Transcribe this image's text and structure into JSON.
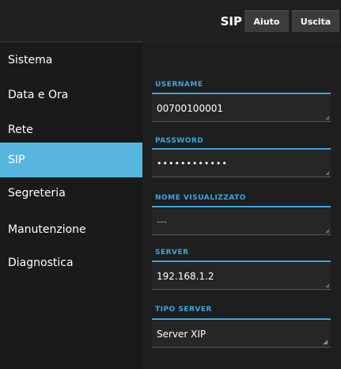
{
  "header": {
    "title": "SIP",
    "help_label": "Aiuto",
    "exit_label": "Uscita"
  },
  "sidebar": {
    "items": [
      {
        "label": "Sistema"
      },
      {
        "label": "Data e Ora"
      },
      {
        "label": "Rete"
      },
      {
        "label": "SIP",
        "active": true
      },
      {
        "label": "Segreteria"
      },
      {
        "label": "Manutenzione"
      },
      {
        "label": "Diagnostica"
      }
    ]
  },
  "form": {
    "username": {
      "label": "USERNAME",
      "value": "00700100001"
    },
    "password": {
      "label": "PASSWORD",
      "value": "••••••••••••"
    },
    "display_name": {
      "label": "NOME VISUALIZZATO",
      "value": "---"
    },
    "server": {
      "label": "SERVER",
      "value": "192.168.1.2"
    },
    "server_type": {
      "label": "TIPO SERVER",
      "value": "Server XIP"
    }
  },
  "colors": {
    "accent": "#3aa7de",
    "active_item": "#58b5e0",
    "background": "#202020"
  }
}
